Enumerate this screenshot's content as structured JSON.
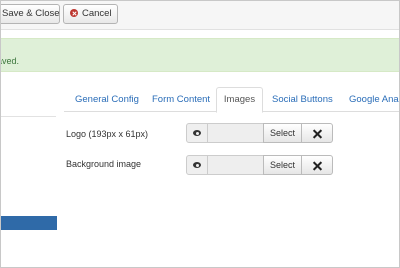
{
  "toolbar": {
    "save_close_label": "Save & Close",
    "cancel_label": "Cancel"
  },
  "alert": {
    "message_fragment": "aved."
  },
  "tabs": [
    {
      "label": "General Config",
      "active": false
    },
    {
      "label": "Form Content",
      "active": false
    },
    {
      "label": "Images",
      "active": true
    },
    {
      "label": "Social Buttons",
      "active": false
    },
    {
      "label": "Google Analy",
      "active": false
    }
  ],
  "fields": {
    "logo": {
      "label": "Logo (193px x 61px)",
      "value": "",
      "select_label": "Select",
      "icons": {
        "preview": "eye-icon",
        "clear": "close-icon"
      }
    },
    "background": {
      "label": "Background image",
      "value": "",
      "select_label": "Select",
      "icons": {
        "preview": "eye-icon",
        "clear": "close-icon"
      }
    }
  },
  "colors": {
    "alert_background": "#dff0d8",
    "alert_text": "#3c763d",
    "link": "#2a6db8",
    "cancel_icon": "#bd362f",
    "sidebar_active": "#2f6aa8"
  }
}
